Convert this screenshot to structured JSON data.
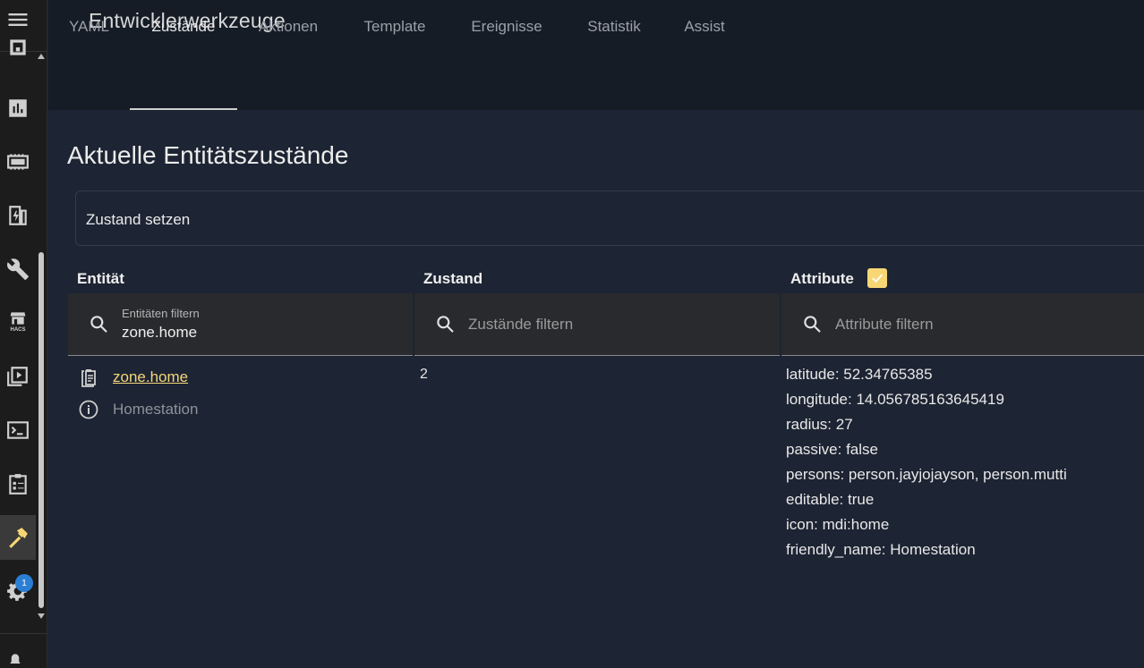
{
  "header": {
    "title": "Entwicklerwerkzeuge",
    "tabs": [
      "YAML",
      "Zustände",
      "Aktionen",
      "Template",
      "Ereignisse",
      "Statistik",
      "Assist"
    ],
    "active_tab": "Zustände"
  },
  "sidebar": {
    "items": [
      "overview-icon",
      "energy-icon",
      "map-icon",
      "logbook-icon",
      "tools-icon",
      "hacs-icon",
      "media-icon",
      "terminal-icon",
      "todo-icon",
      "developer-tools-icon",
      "settings-icon"
    ],
    "hacs_label": "HACS",
    "notification_count": "1"
  },
  "main": {
    "section_title": "Aktuelle Entitätszustände",
    "set_state_label": "Zustand setzen",
    "columns": {
      "entity": "Entität",
      "state": "Zustand",
      "attributes": "Attribute"
    },
    "filters": {
      "entity_label": "Entitäten filtern",
      "entity_value": "zone.home",
      "state_placeholder": "Zustände filtern",
      "attributes_placeholder": "Attribute filtern"
    },
    "row": {
      "entity_id": "zone.home",
      "friendly_name": "Homestation",
      "state": "2",
      "attributes": [
        "latitude: 52.34765385",
        "longitude: 14.056785163645419",
        "radius: 27",
        "passive: false",
        "persons: person.jayjojayson, person.mutti",
        "editable: true",
        "icon: mdi:home",
        "friendly_name: Homestation"
      ]
    }
  },
  "colors": {
    "accent": "#f7d774",
    "link": "#f4d67a",
    "badge": "#2a7fd4",
    "header_bg": "#161c26",
    "content_bg": "#1d2433"
  }
}
